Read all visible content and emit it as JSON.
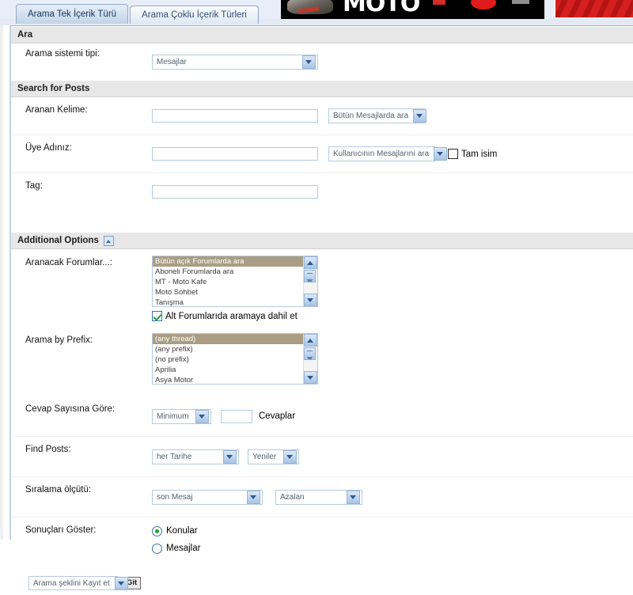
{
  "banner": {
    "word": "MOTO",
    "alt": "motorcycle-ad-banner"
  },
  "tabs": [
    {
      "label": "Arama Tek İçerik Türü",
      "active": true
    },
    {
      "label": "Arama Çoklu İçerik Türleri",
      "active": false
    }
  ],
  "sections": {
    "search": {
      "title": "Ara",
      "system_type_label": "Arama sistemi tipi:",
      "system_type_value": "Mesajlar"
    },
    "posts": {
      "title": "Search for Posts",
      "keyword_label": "Aranan Kelime:",
      "keyword_value": "",
      "keyword_scope_value": "Bütün Mesajlarda ara",
      "username_label": "Üye Adınız:",
      "username_value": "",
      "username_scope_value": "Kullanıcının Mesajlarını ara",
      "exact_name_label": "Tam isim",
      "exact_name_checked": false,
      "tag_label": "Tag:",
      "tag_value": ""
    },
    "additional": {
      "title": "Additional Options",
      "collapse_icon": "collapse-up-icon",
      "forums_label": "Aranacak Forumlar...:",
      "forums_options": [
        "Bütün açık Forumlarda ara",
        "Aboneli Forumlarda ara",
        "MT - Moto Kafe",
        "Moto Sohbet",
        "Tanışma"
      ],
      "forums_selected_index": 0,
      "subforums_label": "Alt Forumlarıda aramaya dahil et",
      "subforums_checked": true,
      "prefix_label": "Arama by Prefix:",
      "prefix_options": [
        "(any thread)",
        "(any prefix)",
        "(no prefix)",
        "Aprilia",
        "Asya Motor"
      ],
      "prefix_selected_index": 0,
      "replies_label": "Cevap Sayısına Göre:",
      "replies_mode_value": "Minimum",
      "replies_count_value": "",
      "replies_suffix": "Cevaplar",
      "find_posts_label": "Find Posts:",
      "find_posts_date_value": "her Tarihe",
      "find_posts_order_value": "Yeniler",
      "sort_label": "Sıralama ölçütü:",
      "sort_by_value": "son Mesaj",
      "sort_dir_value": "Azalan",
      "show_results_label": "Sonuçları Göster:",
      "show_results_options": [
        {
          "label": "Konular",
          "selected": true
        },
        {
          "label": "Mesajlar",
          "selected": false
        }
      ]
    }
  },
  "footer": {
    "save_search_value": "Arama şeklini Kayıt et",
    "go_label": "Git"
  }
}
